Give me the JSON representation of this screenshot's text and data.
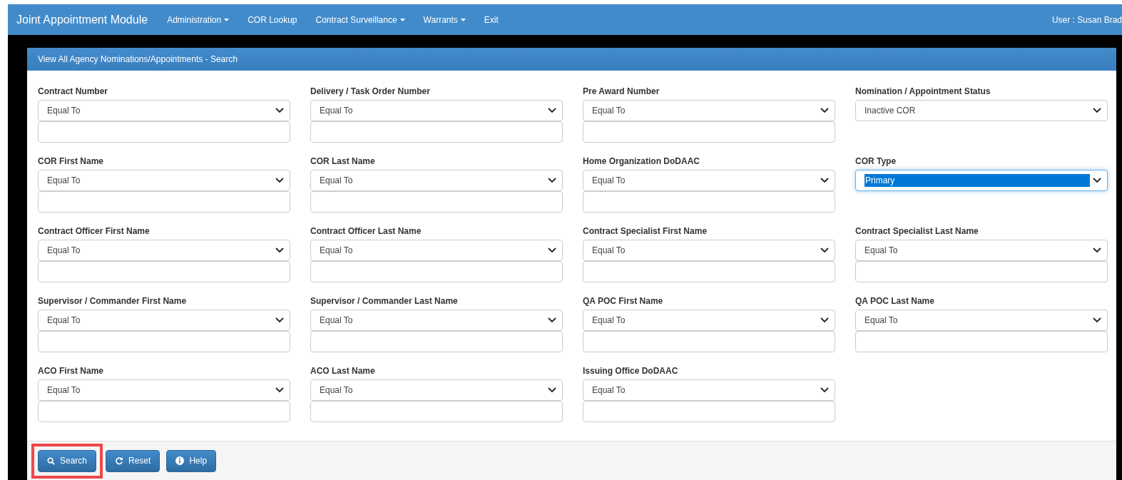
{
  "navbar": {
    "brand": "Joint Appointment Module",
    "items": [
      {
        "label": "Administration",
        "dropdown": true
      },
      {
        "label": "COR Lookup",
        "dropdown": false
      },
      {
        "label": "Contract Surveillance",
        "dropdown": true
      },
      {
        "label": "Warrants",
        "dropdown": true
      },
      {
        "label": "Exit",
        "dropdown": false
      }
    ],
    "user": "User : Susan Brad"
  },
  "panel": {
    "title": "View All Agency Nominations/Appointments - Search",
    "fields": [
      {
        "label": "Contract Number",
        "kind": "select_text",
        "value": "Equal To",
        "focused": false
      },
      {
        "label": "Delivery / Task Order Number",
        "kind": "select_text",
        "value": "Equal To",
        "focused": false
      },
      {
        "label": "Pre Award Number",
        "kind": "select_text",
        "value": "Equal To",
        "focused": false
      },
      {
        "label": "Nomination / Appointment Status",
        "kind": "select",
        "value": "Inactive COR",
        "focused": false
      },
      {
        "label": "COR First Name",
        "kind": "select_text",
        "value": "Equal To",
        "focused": false
      },
      {
        "label": "COR Last Name",
        "kind": "select_text",
        "value": "Equal To",
        "focused": false
      },
      {
        "label": "Home Organization DoDAAC",
        "kind": "select_text",
        "value": "Equal To",
        "focused": false
      },
      {
        "label": "COR Type",
        "kind": "select",
        "value": "Primary",
        "focused": true
      },
      {
        "label": "Contract Officer First Name",
        "kind": "select_text",
        "value": "Equal To",
        "focused": false
      },
      {
        "label": "Contract Officer Last Name",
        "kind": "select_text",
        "value": "Equal To",
        "focused": false
      },
      {
        "label": "Contract Specialist First Name",
        "kind": "select_text",
        "value": "Equal To",
        "focused": false
      },
      {
        "label": "Contract Specialist Last Name",
        "kind": "select_text",
        "value": "Equal To",
        "focused": false
      },
      {
        "label": "Supervisor / Commander First Name",
        "kind": "select_text",
        "value": "Equal To",
        "focused": false
      },
      {
        "label": "Supervisor / Commander Last Name",
        "kind": "select_text",
        "value": "Equal To",
        "focused": false
      },
      {
        "label": "QA POC First Name",
        "kind": "select_text",
        "value": "Equal To",
        "focused": false
      },
      {
        "label": "QA POC Last Name",
        "kind": "select_text",
        "value": "Equal To",
        "focused": false
      },
      {
        "label": "ACO First Name",
        "kind": "select_text",
        "value": "Equal To",
        "focused": false
      },
      {
        "label": "ACO Last Name",
        "kind": "select_text",
        "value": "Equal To",
        "focused": false
      },
      {
        "label": "Issuing Office DoDAAC",
        "kind": "select_text",
        "value": "Equal To",
        "focused": false
      }
    ],
    "buttons": [
      {
        "label": "Search",
        "kind": "search",
        "highlighted": true
      },
      {
        "label": "Reset",
        "kind": "reset",
        "highlighted": false
      },
      {
        "label": "Help",
        "kind": "help",
        "highlighted": false
      }
    ]
  }
}
